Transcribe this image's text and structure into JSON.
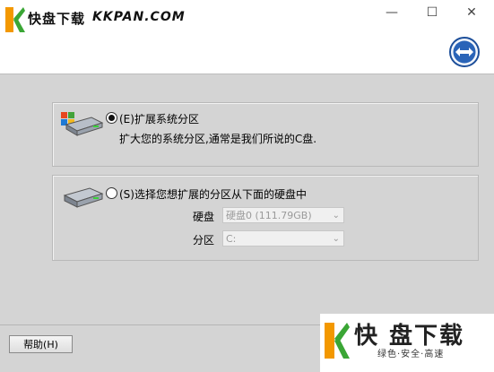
{
  "brand": {
    "name": "快盘下载",
    "url": "KKPAN.COM"
  },
  "window": {
    "minimize": "—",
    "maximize": "☐",
    "close": "✕"
  },
  "options": [
    {
      "label": "(E)扩展系统分区",
      "description": "扩大您的系统分区,通常是我们所说的C盘.",
      "selected": true
    },
    {
      "label": "(S)选择您想扩展的分区从下面的硬盘中",
      "selected": false,
      "fields": [
        {
          "label": "硬盘",
          "value": "硬盘0 (111.79GB)"
        },
        {
          "label": "分区",
          "value": "C:"
        }
      ]
    }
  ],
  "footer": {
    "help_label": "帮助(H)"
  },
  "watermark": {
    "main": "快 盘下载",
    "sub": "绿色·安全·高速"
  },
  "colors": {
    "panel": "#d4d4d4",
    "accent_blue": "#1d4f9a",
    "logo_orange": "#f39800",
    "logo_green": "#3aa635"
  }
}
